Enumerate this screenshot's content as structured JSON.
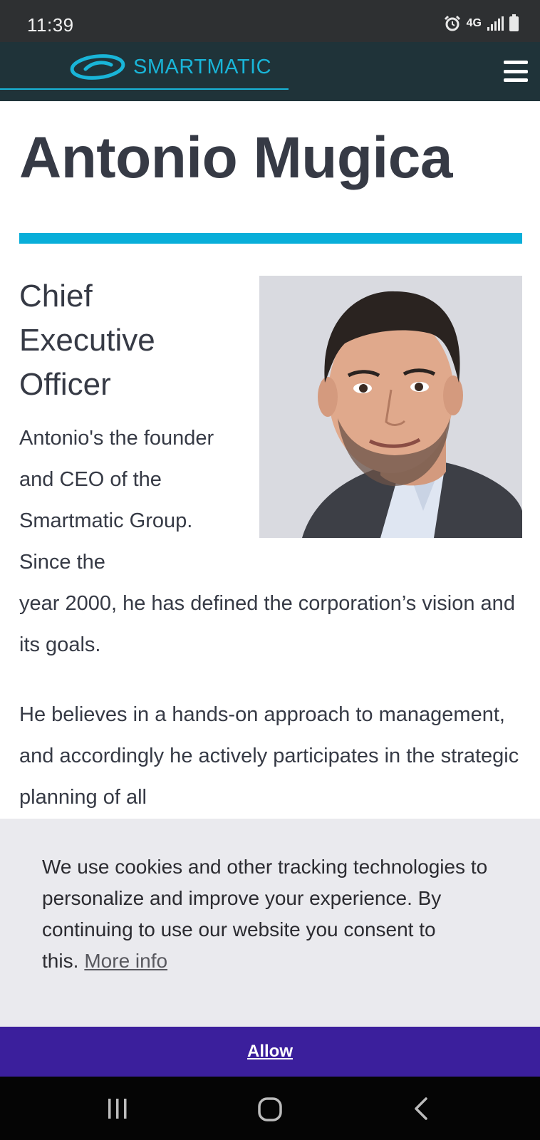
{
  "status_bar": {
    "time": "11:39",
    "network": "4G",
    "icons": [
      "alarm-icon",
      "network-icon",
      "signal-icon",
      "battery-icon"
    ]
  },
  "header": {
    "logo_text": "SMARTMATIC",
    "menu_icon": "hamburger-menu-icon",
    "accent_color": "#19b5d8",
    "background_color": "#1f3339"
  },
  "profile": {
    "name": "Antonio Mugica",
    "role": "Chief Executive Officer",
    "bio_p1_part1": "Antonio's the founder and CEO of the Smartmatic Group. Since the",
    "bio_p1_part2": "year 2000, he has defined the corporation’s vision and its goals.",
    "bio_p2": "He believes in a hands-on approach to management, and accordingly he actively participates in the strategic planning of all",
    "rule_color": "#08aed9"
  },
  "cookie_banner": {
    "text": "We use cookies and other tracking technologies to personalize and improve your experience. By continuing to use our website you consent to this.",
    "more_info_label": "More info",
    "allow_label": "Allow",
    "allow_color": "#3b1f9c"
  },
  "nav_bar": {
    "icons": [
      "recent-apps-icon",
      "home-icon",
      "back-icon"
    ]
  }
}
